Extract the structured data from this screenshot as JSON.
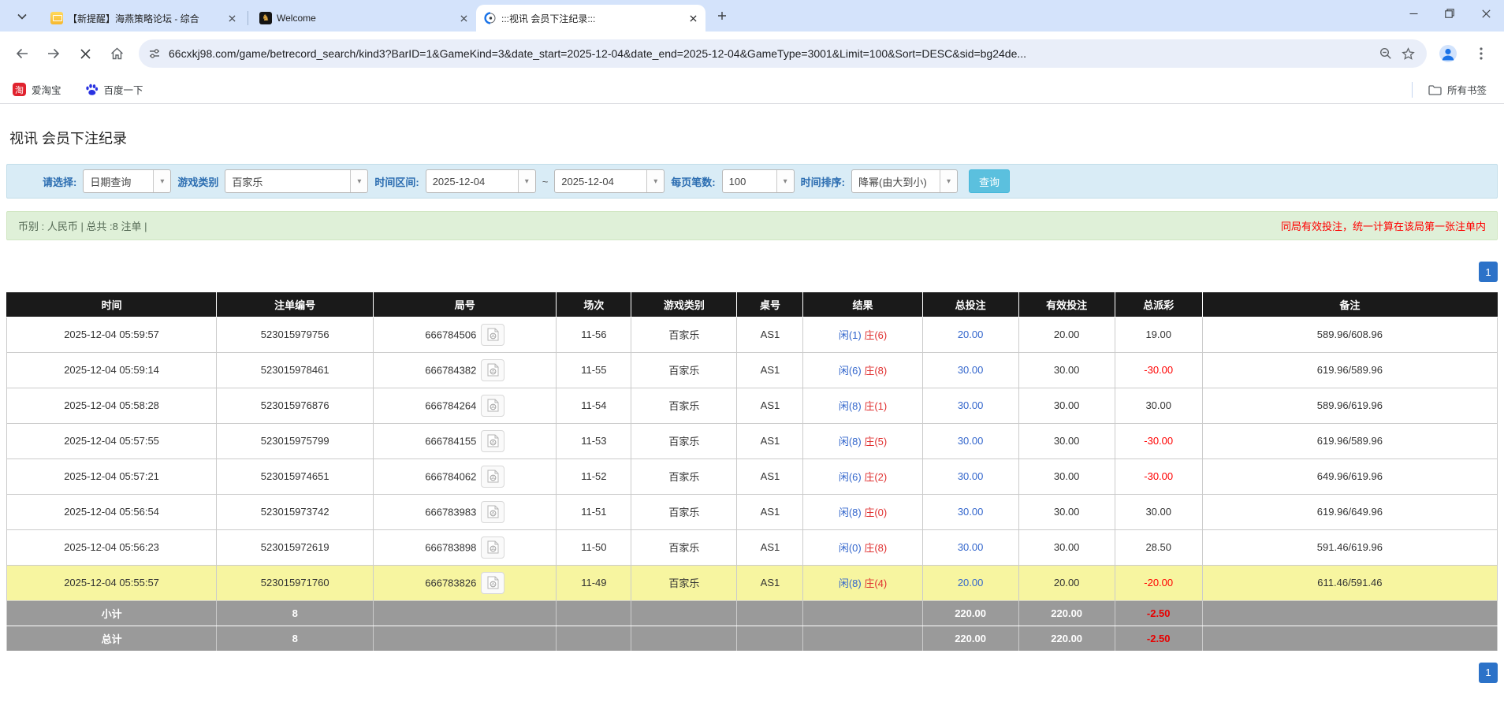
{
  "browser": {
    "tabs": [
      {
        "title": "【新提醒】海燕策略论坛 - 综合",
        "active": false
      },
      {
        "title": "Welcome",
        "active": false
      },
      {
        "title": ":::视讯 会员下注纪录:::",
        "active": true
      }
    ],
    "url": "66cxkj98.com/game/betrecord_search/kind3?BarID=1&GameKind=3&date_start=2025-12-04&date_end=2025-12-04&GameType=3001&Limit=100&Sort=DESC&sid=bg24de...",
    "bookmarks": {
      "items": [
        {
          "label": "爱淘宝"
        },
        {
          "label": "百度一下"
        }
      ],
      "all_label": "所有书签"
    }
  },
  "page": {
    "title": "视讯 会员下注纪录",
    "filters": {
      "select_label": "请选择:",
      "select_value": "日期查询",
      "game_type_label": "游戏类别",
      "game_type_value": "百家乐",
      "date_range_label": "时间区间:",
      "date_start": "2025-12-04",
      "date_separator": "~",
      "date_end": "2025-12-04",
      "page_size_label": "每页笔数:",
      "page_size_value": "100",
      "sort_label": "时间排序:",
      "sort_value": "降幂(由大到小)",
      "search_button": "查询"
    },
    "info_bar": {
      "left": "币别 : 人民币 | 总共 :8 注单 |",
      "right": "同局有效投注，统一计算在该局第一张注单内"
    },
    "pagination": {
      "top": "1",
      "bottom": "1"
    },
    "table": {
      "headers": [
        "时间",
        "注单编号",
        "局号",
        "场次",
        "游戏类别",
        "桌号",
        "结果",
        "总投注",
        "有效投注",
        "总派彩",
        "备注"
      ],
      "rows": [
        {
          "time": "2025-12-04 05:59:57",
          "order_id": "523015979756",
          "round_id": "666784506",
          "session": "11-56",
          "game": "百家乐",
          "table_no": "AS1",
          "result_player": "闲(1)",
          "result_banker": "庄(6)",
          "total_bet": "20.00",
          "valid_bet": "20.00",
          "payout": "19.00",
          "remark": "589.96/608.96",
          "highlight": false
        },
        {
          "time": "2025-12-04 05:59:14",
          "order_id": "523015978461",
          "round_id": "666784382",
          "session": "11-55",
          "game": "百家乐",
          "table_no": "AS1",
          "result_player": "闲(6)",
          "result_banker": "庄(8)",
          "total_bet": "30.00",
          "valid_bet": "30.00",
          "payout": "-30.00",
          "remark": "619.96/589.96",
          "highlight": false
        },
        {
          "time": "2025-12-04 05:58:28",
          "order_id": "523015976876",
          "round_id": "666784264",
          "session": "11-54",
          "game": "百家乐",
          "table_no": "AS1",
          "result_player": "闲(8)",
          "result_banker": "庄(1)",
          "total_bet": "30.00",
          "valid_bet": "30.00",
          "payout": "30.00",
          "remark": "589.96/619.96",
          "highlight": false
        },
        {
          "time": "2025-12-04 05:57:55",
          "order_id": "523015975799",
          "round_id": "666784155",
          "session": "11-53",
          "game": "百家乐",
          "table_no": "AS1",
          "result_player": "闲(8)",
          "result_banker": "庄(5)",
          "total_bet": "30.00",
          "valid_bet": "30.00",
          "payout": "-30.00",
          "remark": "619.96/589.96",
          "highlight": false
        },
        {
          "time": "2025-12-04 05:57:21",
          "order_id": "523015974651",
          "round_id": "666784062",
          "session": "11-52",
          "game": "百家乐",
          "table_no": "AS1",
          "result_player": "闲(6)",
          "result_banker": "庄(2)",
          "total_bet": "30.00",
          "valid_bet": "30.00",
          "payout": "-30.00",
          "remark": "649.96/619.96",
          "highlight": false
        },
        {
          "time": "2025-12-04 05:56:54",
          "order_id": "523015973742",
          "round_id": "666783983",
          "session": "11-51",
          "game": "百家乐",
          "table_no": "AS1",
          "result_player": "闲(8)",
          "result_banker": "庄(0)",
          "total_bet": "30.00",
          "valid_bet": "30.00",
          "payout": "30.00",
          "remark": "619.96/649.96",
          "highlight": false
        },
        {
          "time": "2025-12-04 05:56:23",
          "order_id": "523015972619",
          "round_id": "666783898",
          "session": "11-50",
          "game": "百家乐",
          "table_no": "AS1",
          "result_player": "闲(0)",
          "result_banker": "庄(8)",
          "total_bet": "30.00",
          "valid_bet": "30.00",
          "payout": "28.50",
          "remark": "591.46/619.96",
          "highlight": false
        },
        {
          "time": "2025-12-04 05:55:57",
          "order_id": "523015971760",
          "round_id": "666783826",
          "session": "11-49",
          "game": "百家乐",
          "table_no": "AS1",
          "result_player": "闲(8)",
          "result_banker": "庄(4)",
          "total_bet": "20.00",
          "valid_bet": "20.00",
          "payout": "-20.00",
          "remark": "611.46/591.46",
          "highlight": true
        }
      ],
      "footer": [
        {
          "label": "小计",
          "count": "8",
          "total_bet": "220.00",
          "valid_bet": "220.00",
          "payout": "-2.50"
        },
        {
          "label": "总计",
          "count": "8",
          "total_bet": "220.00",
          "valid_bet": "220.00",
          "payout": "-2.50"
        }
      ]
    }
  }
}
